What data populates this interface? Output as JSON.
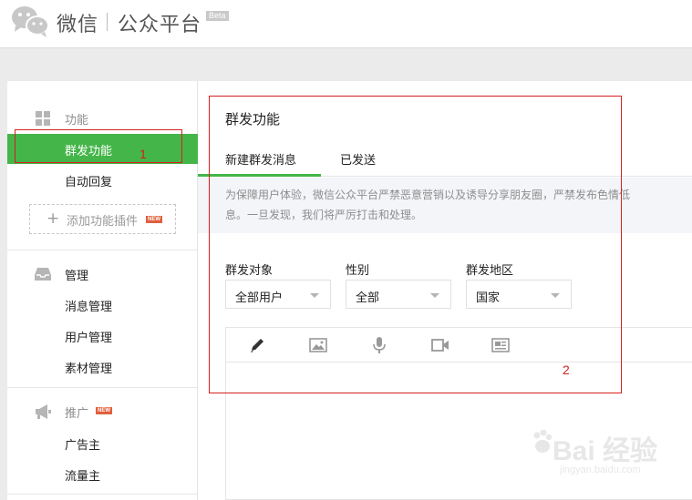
{
  "header": {
    "brand_name": "微信",
    "platform": "公众平台",
    "beta": "Beta"
  },
  "sidebar": {
    "function_group": {
      "label": "功能",
      "items": [
        {
          "label": "群发功能"
        },
        {
          "label": "自动回复"
        }
      ],
      "add_plugin": "添加功能插件",
      "new_badge": "NEW"
    },
    "manage_group": {
      "label": "管理",
      "items": [
        {
          "label": "消息管理"
        },
        {
          "label": "用户管理"
        },
        {
          "label": "素材管理"
        }
      ]
    },
    "promote_group": {
      "label": "推广",
      "new_badge": "NEW",
      "items": [
        {
          "label": "广告主"
        },
        {
          "label": "流量主"
        }
      ]
    }
  },
  "main": {
    "title": "群发功能",
    "tabs": [
      {
        "label": "新建群发消息"
      },
      {
        "label": "已发送"
      }
    ],
    "notice": {
      "line1": "为保障用户体验，微信公众平台严禁恶意营销以及诱导分享朋友圈，严禁发布色情低",
      "line2": "息。一旦发现，我们将严厉打击和处理。"
    },
    "filters": {
      "target_label": "群发对象",
      "target_value": "全部用户",
      "gender_label": "性别",
      "gender_value": "全部",
      "region_label": "群发地区",
      "region_value": "国家"
    },
    "editor_tools": [
      "pencil-icon",
      "image-icon",
      "microphone-icon",
      "video-icon",
      "article-icon"
    ]
  },
  "annotations": {
    "box1_number": "1",
    "box2_number": "2"
  },
  "watermark": {
    "text": "Bai 经验",
    "url": "jingyan.baidu.com"
  },
  "colors": {
    "accent": "#44b549",
    "annotation": "#d61f1f",
    "new_badge": "#e15f3d"
  }
}
